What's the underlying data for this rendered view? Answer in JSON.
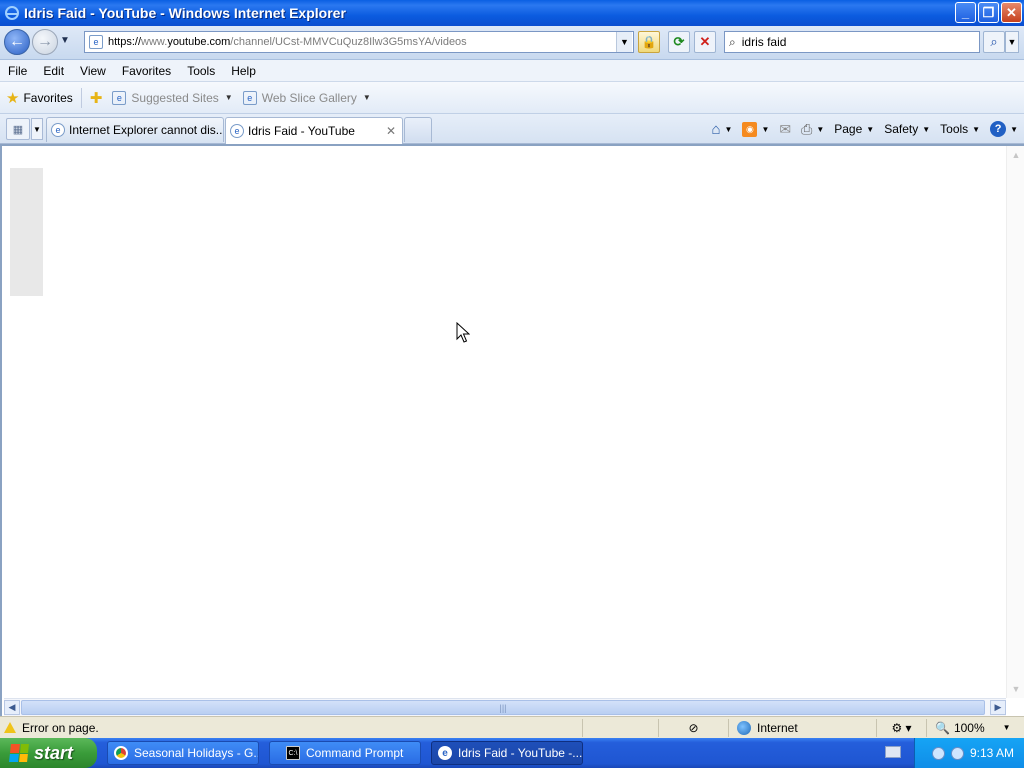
{
  "window": {
    "title": "Idris Faid - YouTube - Windows Internet Explorer",
    "buttons": {
      "minimize": "_",
      "maximize": "❐",
      "close": "✕"
    }
  },
  "address": {
    "scheme": "https://",
    "pre_host": "www.",
    "host": "youtube.com",
    "path": "/channel/UCst-MMVCuQuz8Ilw3G5msYA/videos"
  },
  "search": {
    "value": "idris faid"
  },
  "menu": [
    "File",
    "Edit",
    "View",
    "Favorites",
    "Tools",
    "Help"
  ],
  "favorites": {
    "label": "Favorites",
    "items": [
      "Suggested Sites",
      "Web Slice Gallery"
    ]
  },
  "tabs": [
    {
      "label": "Internet Explorer cannot dis...",
      "active": false
    },
    {
      "label": "Idris Faid - YouTube",
      "active": true
    }
  ],
  "commandbar": {
    "page": "Page",
    "safety": "Safety",
    "tools": "Tools"
  },
  "status": {
    "message": "Error on page.",
    "zone": "Internet",
    "zoom": "100%"
  },
  "taskbar": {
    "start": "start",
    "tasks": [
      "Seasonal Holidays - G...",
      "Command Prompt",
      "Idris Faid - YouTube -..."
    ],
    "clock": "9:13 AM"
  },
  "colors": {
    "titlebar": "#0a5fe3",
    "taskbar": "#245edb",
    "start": "#3a9c3a"
  }
}
